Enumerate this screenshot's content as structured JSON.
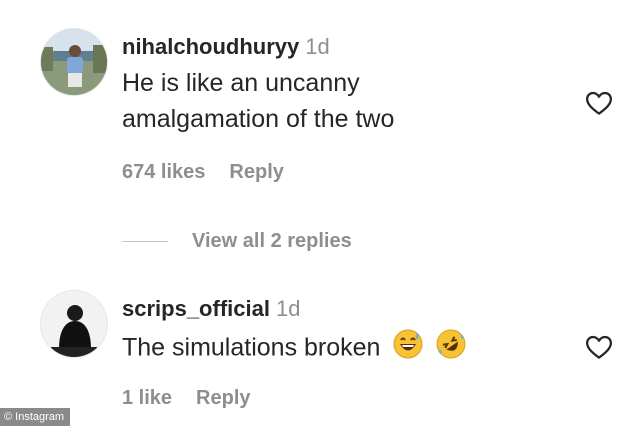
{
  "comments": [
    {
      "username": "nihalchoudhuryy",
      "time": "1d",
      "text_line1": "He is like an uncanny",
      "text_line2": "amalgamation of the two",
      "likes": "674 likes",
      "reply": "Reply",
      "avatar_icon": "profile-photo",
      "heart_icon": "heart-outline-icon"
    },
    {
      "username": "scrips_official",
      "time": "1d",
      "text": "The simulations broken",
      "emoji_1": "grinning-sweat-emoji",
      "emoji_2": "rolling-on-floor-laughing-emoji",
      "likes": "1 like",
      "reply": "Reply",
      "avatar_icon": "profile-photo",
      "heart_icon": "heart-outline-icon"
    }
  ],
  "view_replies": "View all 2 replies",
  "watermark": "© Instagram",
  "colors": {
    "primary_text": "#262626",
    "secondary_text": "#8e8e8e",
    "emoji_yellow": "#f7c234"
  }
}
